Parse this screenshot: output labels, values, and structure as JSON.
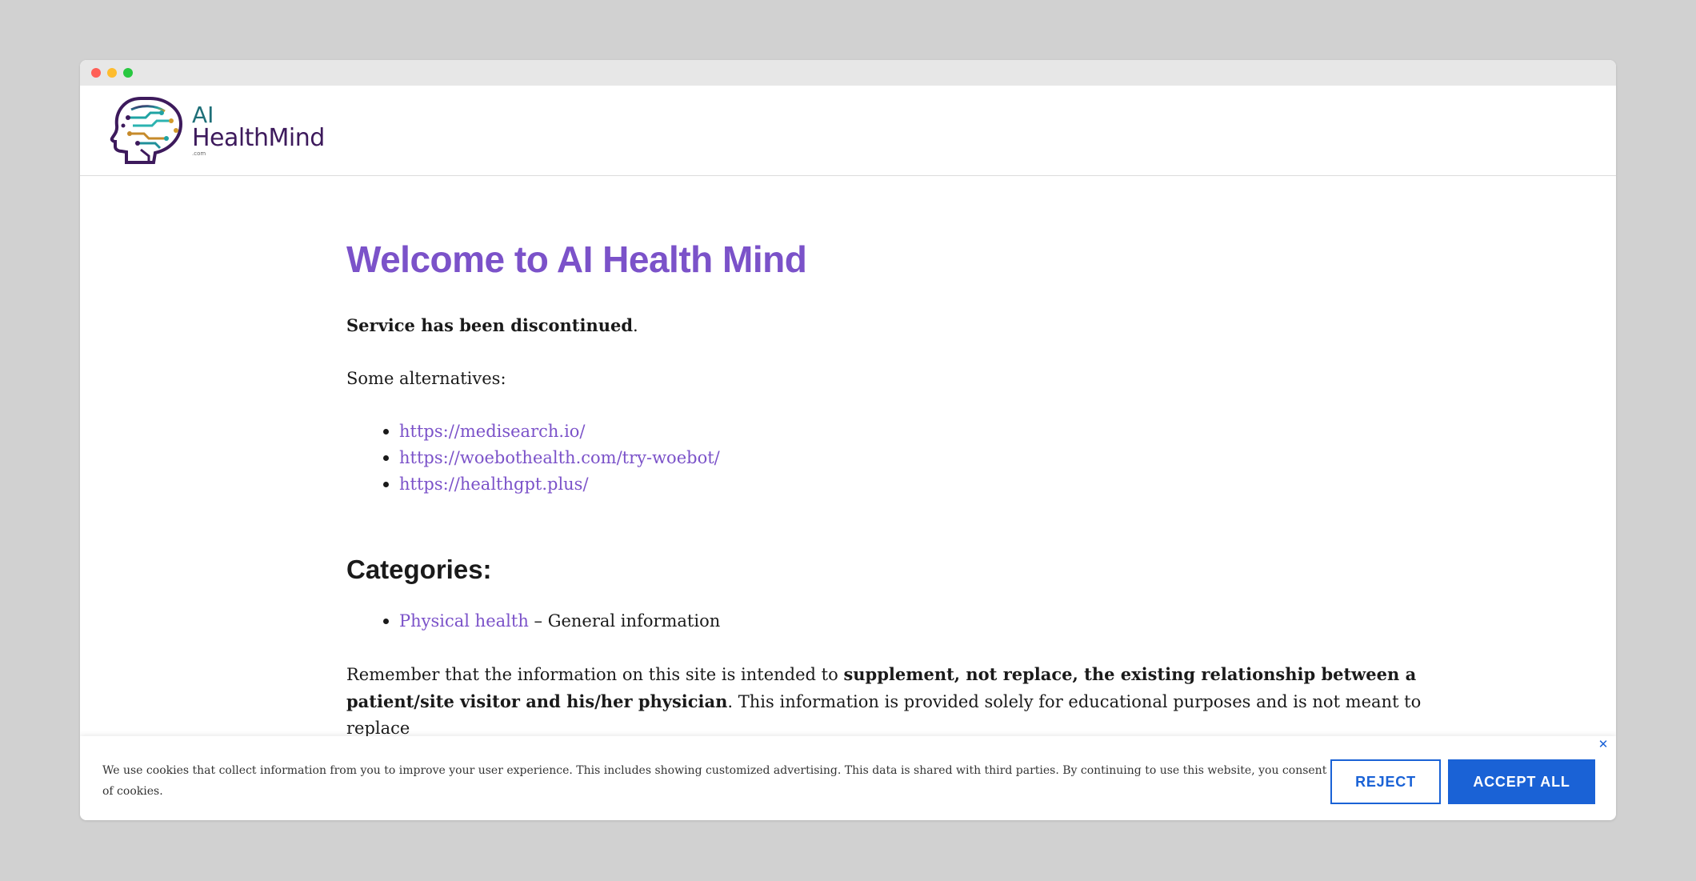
{
  "header": {
    "logo_line1": "AI",
    "logo_line2": "HealthMind",
    "logo_line3": ".com"
  },
  "main": {
    "title": "Welcome to AI Health Mind",
    "discontinued_bold": "Service has been discontinued",
    "discontinued_tail": ".",
    "alternatives_intro": "Some alternatives:",
    "alternatives": [
      "https://medisearch.io/",
      "https://woebothealth.com/try-woebot/",
      "https://healthgpt.plus/"
    ],
    "categories_title": "Categories:",
    "categories": [
      {
        "link": "Physical health",
        "description": " – General information"
      }
    ],
    "remember_1": "Remember that the information on this site is intended to ",
    "remember_bold": "supplement, not replace, the existing relationship between a patient/site visitor and his/her physician",
    "remember_2": ". This information is provided solely for educational purposes and is not meant to replace"
  },
  "cookie": {
    "text": "We use cookies that collect information from you to improve your user experience. This includes showing customized advertising. This data is shared with third parties. By continuing to use this website, you consent to our use of cookies.",
    "reject_label": "REJECT",
    "accept_label": "ACCEPT ALL",
    "close_icon": "close-icon"
  },
  "colors": {
    "accent": "#7b52c9",
    "button_blue": "#1a62d6",
    "background": "#d1d1d1"
  }
}
